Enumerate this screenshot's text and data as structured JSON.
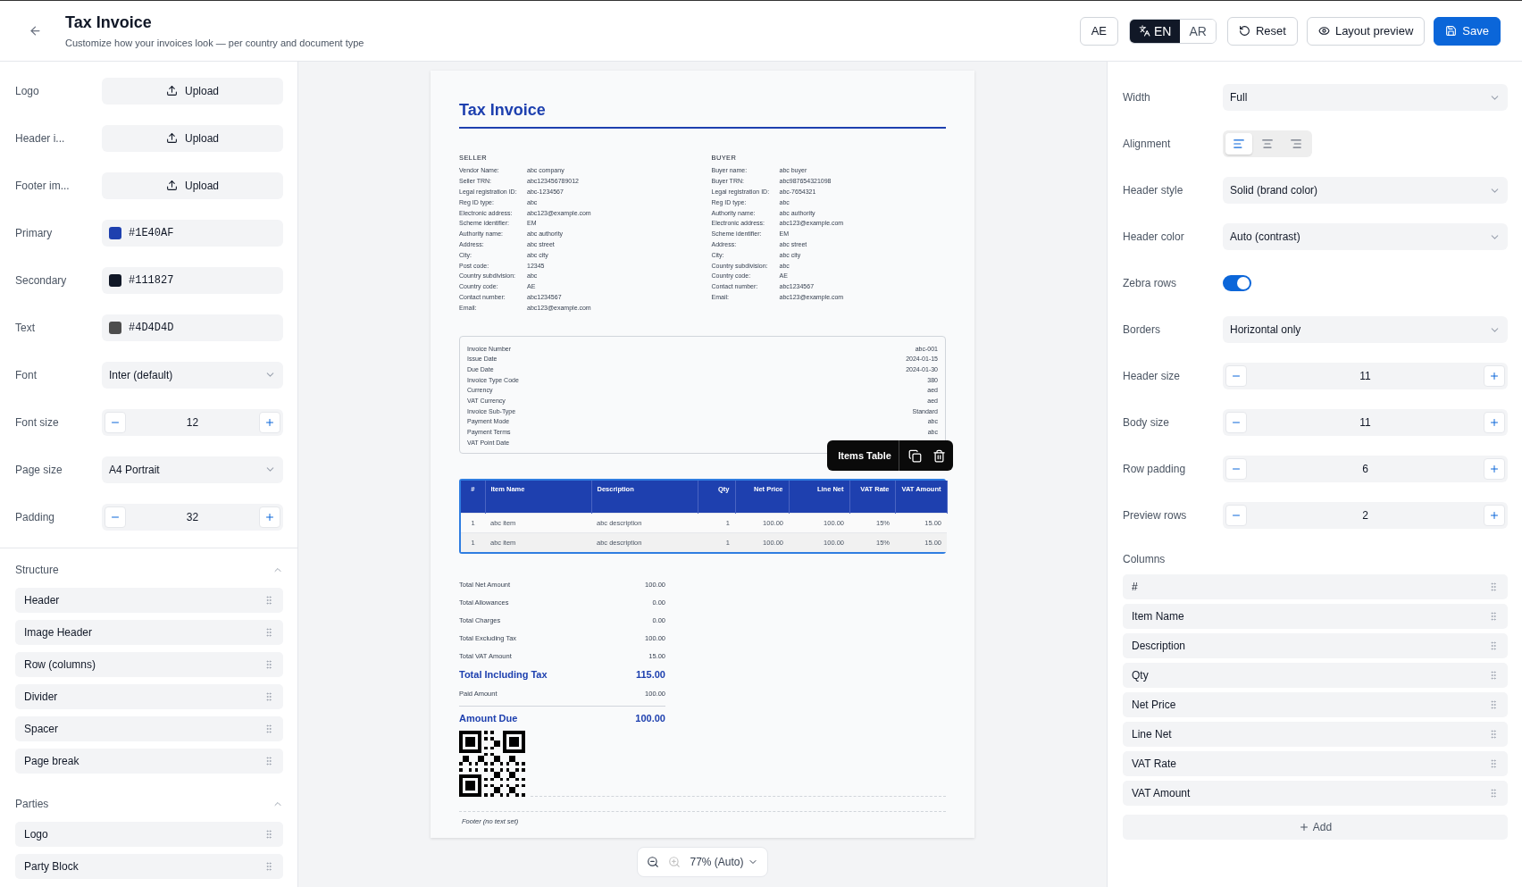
{
  "header": {
    "title": "Tax Invoice",
    "subtitle": "Customize how your invoices look — per country and document type",
    "country": "AE",
    "languages": [
      {
        "label": "EN",
        "selected": true
      },
      {
        "label": "AR",
        "selected": false
      }
    ],
    "buttons": [
      {
        "label": "Reset",
        "kind": "reset"
      },
      {
        "label": "Layout preview",
        "kind": "preview"
      },
      {
        "label": "Save",
        "kind": "save"
      }
    ]
  },
  "left": {
    "settings": [
      {
        "label": "Logo",
        "kind": "upload",
        "value": "Upload"
      },
      {
        "label": "Header i...",
        "kind": "upload",
        "value": "Upload"
      },
      {
        "label": "Footer im...",
        "kind": "upload",
        "value": "Upload"
      },
      {
        "label": "Primary",
        "kind": "color",
        "value": "#1E40AF",
        "color": "#1e40af"
      },
      {
        "label": "Secondary",
        "kind": "color",
        "value": "#111827",
        "color": "#111827"
      },
      {
        "label": "Text",
        "kind": "color",
        "value": "#4D4D4D",
        "color": "#4d4d4d"
      },
      {
        "label": "Font",
        "kind": "select",
        "value": "Inter (default)"
      },
      {
        "label": "Font size",
        "kind": "stepper",
        "value": "12"
      },
      {
        "label": "Page size",
        "kind": "select",
        "value": "A4 Portrait"
      },
      {
        "label": "Padding",
        "kind": "stepper",
        "value": "32"
      }
    ],
    "sections": [
      {
        "title": "Structure",
        "expanded": true,
        "items": [
          "Header",
          "Image Header",
          "Row (columns)",
          "Divider",
          "Spacer",
          "Page break"
        ]
      },
      {
        "title": "Parties",
        "expanded": true,
        "items": [
          "Logo",
          "Party Block"
        ]
      }
    ]
  },
  "invoice": {
    "title": "Tax Invoice",
    "parties": [
      {
        "heading": "SELLER",
        "rows": [
          {
            "label": "Vendor Name:",
            "value": "abc company"
          },
          {
            "label": "Seller TRN:",
            "value": "abc123456789012"
          },
          {
            "label": "Legal registration ID:",
            "value": "abc-1234567"
          },
          {
            "label": "Reg ID type:",
            "value": "abc"
          },
          {
            "label": "Electronic address:",
            "value": "abc123@example.com"
          },
          {
            "label": "Scheme identifier:",
            "value": "EM"
          },
          {
            "label": "Authority name:",
            "value": "abc authority"
          },
          {
            "label": "Address:",
            "value": "abc street"
          },
          {
            "label": "City:",
            "value": "abc city"
          },
          {
            "label": "Post code:",
            "value": "12345"
          },
          {
            "label": "Country subdivision:",
            "value": "abc"
          },
          {
            "label": "Country code:",
            "value": "AE"
          },
          {
            "label": "Contact number:",
            "value": "abc1234567"
          },
          {
            "label": "Email:",
            "value": "abc123@example.com"
          }
        ]
      },
      {
        "heading": "BUYER",
        "rows": [
          {
            "label": "Buyer name:",
            "value": "abc buyer"
          },
          {
            "label": "Buyer TRN:",
            "value": "abc987654321098"
          },
          {
            "label": "Legal registration ID:",
            "value": "abc-7654321"
          },
          {
            "label": "Reg ID type:",
            "value": "abc"
          },
          {
            "label": "Authority name:",
            "value": "abc authority"
          },
          {
            "label": "Electronic address:",
            "value": "abc123@example.com"
          },
          {
            "label": "Scheme identifier:",
            "value": "EM"
          },
          {
            "label": "Address:",
            "value": "abc street"
          },
          {
            "label": "City:",
            "value": "abc city"
          },
          {
            "label": "Country subdivision:",
            "value": "abc"
          },
          {
            "label": "Country code:",
            "value": "AE"
          },
          {
            "label": "Contact number:",
            "value": "abc1234567"
          },
          {
            "label": "Email:",
            "value": "abc123@example.com"
          }
        ]
      }
    ],
    "details": [
      {
        "label": "Invoice Number",
        "value": "abc-001"
      },
      {
        "label": "Issue Date",
        "value": "2024-01-15"
      },
      {
        "label": "Due Date",
        "value": "2024-01-30"
      },
      {
        "label": "Invoice Type Code",
        "value": "380"
      },
      {
        "label": "Currency",
        "value": "aed"
      },
      {
        "label": "VAT Currency",
        "value": "aed"
      },
      {
        "label": "Invoice Sub-Type",
        "value": "Standard"
      },
      {
        "label": "Payment Mode",
        "value": "abc"
      },
      {
        "label": "Payment Terms",
        "value": "abc"
      },
      {
        "label": "VAT Point Date"
      }
    ],
    "items_table": {
      "toolbar_label": "Items Table",
      "selected": true,
      "columns": [
        {
          "label": "#",
          "numeric": false
        },
        {
          "label": "Item Name",
          "numeric": false
        },
        {
          "label": "Description",
          "numeric": false
        },
        {
          "label": "Qty",
          "numeric": true
        },
        {
          "label": "Net Price",
          "numeric": true
        },
        {
          "label": "Line Net",
          "numeric": true
        },
        {
          "label": "VAT Rate",
          "numeric": true
        },
        {
          "label": "VAT Amount",
          "numeric": true
        }
      ],
      "rows": [
        [
          "1",
          "abc item",
          "abc description",
          "1",
          "100.00",
          "100.00",
          "15%",
          "15.00"
        ],
        [
          "1",
          "abc item",
          "abc description",
          "1",
          "100.00",
          "100.00",
          "15%",
          "15.00"
        ]
      ]
    },
    "totals": [
      {
        "label": "Total Net Amount",
        "value": "100.00",
        "kind": "normal"
      },
      {
        "label": "Total Allowances",
        "value": "0.00",
        "kind": "normal"
      },
      {
        "label": "Total Charges",
        "value": "0.00",
        "kind": "normal"
      },
      {
        "label": "Total Excluding Tax",
        "value": "100.00",
        "kind": "normal"
      },
      {
        "label": "Total VAT Amount",
        "value": "15.00",
        "kind": "normal"
      },
      {
        "label": "Total Including Tax",
        "value": "115.00",
        "kind": "grand"
      },
      {
        "label": "Paid Amount",
        "value": "100.00",
        "kind": "normal"
      },
      {
        "label": "Amount Due",
        "value": "100.00",
        "kind": "due"
      }
    ],
    "footer": "Footer (no text set)"
  },
  "zoom": {
    "value": "77% (Auto)"
  },
  "right": {
    "settings": [
      {
        "label": "Width",
        "kind": "select",
        "value": "Full"
      },
      {
        "label": "Alignment",
        "kind": "align",
        "options": [
          {
            "kind": "left",
            "selected": true
          },
          {
            "kind": "center",
            "selected": false
          },
          {
            "kind": "right",
            "selected": false
          }
        ]
      },
      {
        "label": "Header style",
        "kind": "select",
        "value": "Solid (brand color)"
      },
      {
        "label": "Header color",
        "kind": "select",
        "value": "Auto (contrast)"
      },
      {
        "label": "Zebra rows",
        "kind": "toggle",
        "on": true
      },
      {
        "label": "Borders",
        "kind": "select",
        "value": "Horizontal only"
      },
      {
        "label": "Header size",
        "kind": "stepper",
        "value": "11"
      },
      {
        "label": "Body size",
        "kind": "stepper",
        "value": "11"
      },
      {
        "label": "Row padding",
        "kind": "stepper",
        "value": "6"
      },
      {
        "label": "Preview rows",
        "kind": "stepper",
        "value": "2"
      }
    ],
    "columns_title": "Columns",
    "columns": [
      "#",
      "Item Name",
      "Description",
      "Qty",
      "Net Price",
      "Line Net",
      "VAT Rate",
      "VAT Amount"
    ],
    "add_label": "Add"
  }
}
